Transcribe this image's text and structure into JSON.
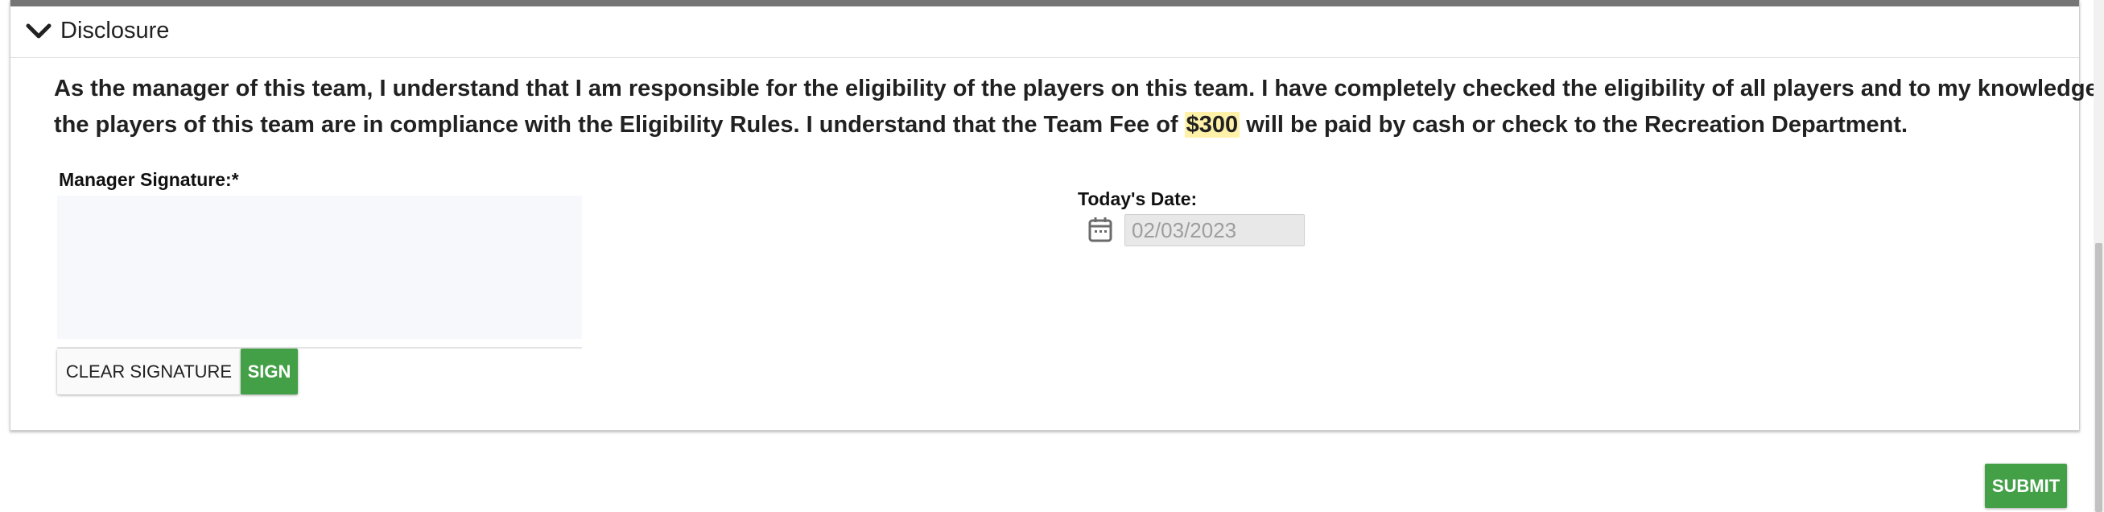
{
  "section": {
    "title": "Disclosure",
    "icon": "chevron-down-icon"
  },
  "disclosure": {
    "line1": "As the manager of this team, I understand that I am responsible for the eligibility of the players on this team. I have completely checked the eligibility of all players and to my knowledge",
    "line2_before": "the players of this team are in compliance with the Eligibility Rules. I understand that the Team Fee of ",
    "fee": "$300",
    "line2_after": " will be paid by cash or check to the Recreation Department."
  },
  "signature": {
    "label": "Manager Signature:*",
    "clear_label": "CLEAR SIGNATURE",
    "sign_label": "SIGN"
  },
  "date": {
    "label": "Today's Date:",
    "value": "02/03/2023",
    "icon": "calendar-icon"
  },
  "submit_label": "SUBMIT",
  "colors": {
    "green": "#43a047",
    "highlight": "#fff2a8",
    "topbar": "#757575",
    "sigpad": "#f7f8fc"
  }
}
